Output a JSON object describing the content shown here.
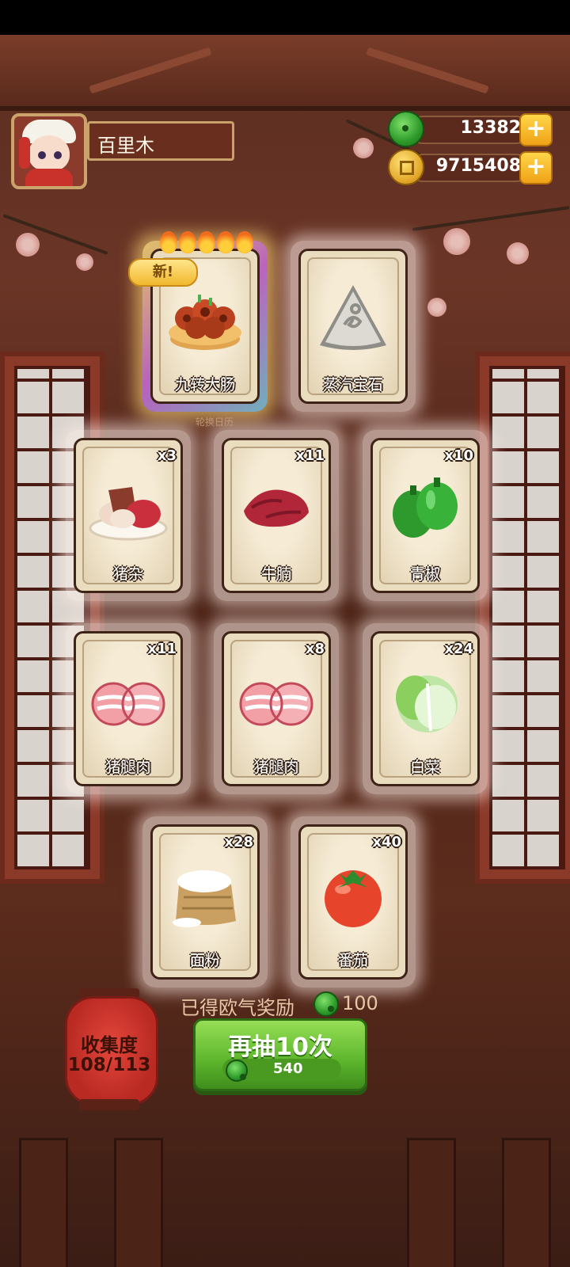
{
  "player": {
    "name": "百里木"
  },
  "currencies": [
    {
      "icon": "jade-icon",
      "value": "13382"
    },
    {
      "icon": "coin-icon",
      "value": "9715408"
    }
  ],
  "cards": [
    {
      "name": "九转大肠",
      "qty": "",
      "rarity": "rare",
      "is_new": true,
      "new_label": "新!",
      "art": "braised-intestine-dish"
    },
    {
      "name": "蒸汽宝石",
      "qty": "",
      "rarity": "normal",
      "art": "steam-gem"
    },
    {
      "name": "猪杂",
      "qty": "x3",
      "rarity": "normal",
      "art": "pork-offal"
    },
    {
      "name": "牛腩",
      "qty": "x11",
      "rarity": "normal",
      "art": "beef-brisket"
    },
    {
      "name": "青椒",
      "qty": "x10",
      "rarity": "normal",
      "art": "green-pepper"
    },
    {
      "name": "猪腿肉",
      "qty": "x11",
      "rarity": "normal",
      "art": "pork-leg"
    },
    {
      "name": "猪腿肉",
      "qty": "x8",
      "rarity": "normal",
      "art": "pork-leg"
    },
    {
      "name": "白菜",
      "qty": "x24",
      "rarity": "normal",
      "art": "cabbage"
    },
    {
      "name": "面粉",
      "qty": "x28",
      "rarity": "normal",
      "art": "flour-sack"
    },
    {
      "name": "番茄",
      "qty": "x40",
      "rarity": "normal",
      "art": "tomato"
    }
  ],
  "sub_caption": "轮换日历",
  "reward": {
    "label": "已得欧气奖励",
    "value": "100",
    "icon": "jade-icon"
  },
  "collection": {
    "label": "收集度",
    "progress": "108/113"
  },
  "draw_button": {
    "label": "再抽10次",
    "cost": "540",
    "icon": "jade-icon"
  },
  "colors": {
    "accent_green": "#5cb52c",
    "card_bg": "#eadcbf",
    "wood": "#5a2d21"
  }
}
